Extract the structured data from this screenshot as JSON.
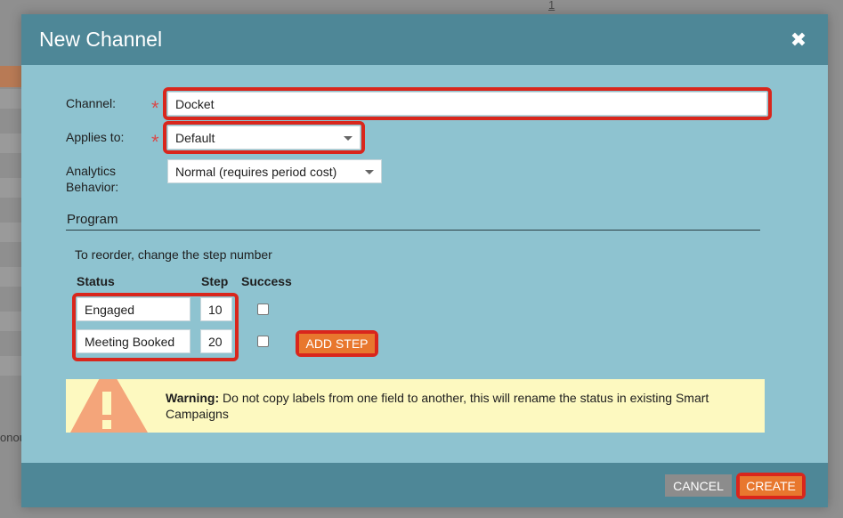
{
  "background": {
    "page_number": "1",
    "partial_text": "onou"
  },
  "dialog": {
    "title": "New Channel",
    "close_icon": "close-icon",
    "required_marker": "*",
    "fields": {
      "channel": {
        "label": "Channel:",
        "value": "Docket"
      },
      "applies_to": {
        "label": "Applies to:",
        "value": "Default"
      },
      "analytics_behavior": {
        "label_line1": "Analytics",
        "label_line2": "Behavior:",
        "value": "Normal (requires period cost)"
      }
    },
    "program": {
      "section_title": "Program",
      "hint": "To reorder, change the step number",
      "columns": {
        "status": "Status",
        "step": "Step",
        "success": "Success"
      },
      "steps": [
        {
          "status": "Engaged",
          "step": "10",
          "success": false
        },
        {
          "status": "Meeting Booked",
          "step": "20",
          "success": false
        }
      ],
      "add_step_label": "ADD STEP"
    },
    "warning": {
      "icon": "warning-triangle-icon",
      "bold": "Warning:",
      "text": "Do not copy labels from one field to another, this will rename the status in existing Smart Campaigns"
    },
    "footer": {
      "cancel_label": "CANCEL",
      "create_label": "CREATE"
    },
    "colors": {
      "header": "#4e8797",
      "body": "#8ec3d0",
      "accent_orange": "#e8772e",
      "highlight_red": "#d9261c",
      "required_red": "#d84b4b",
      "warning_bg": "#fdf9c0"
    }
  }
}
